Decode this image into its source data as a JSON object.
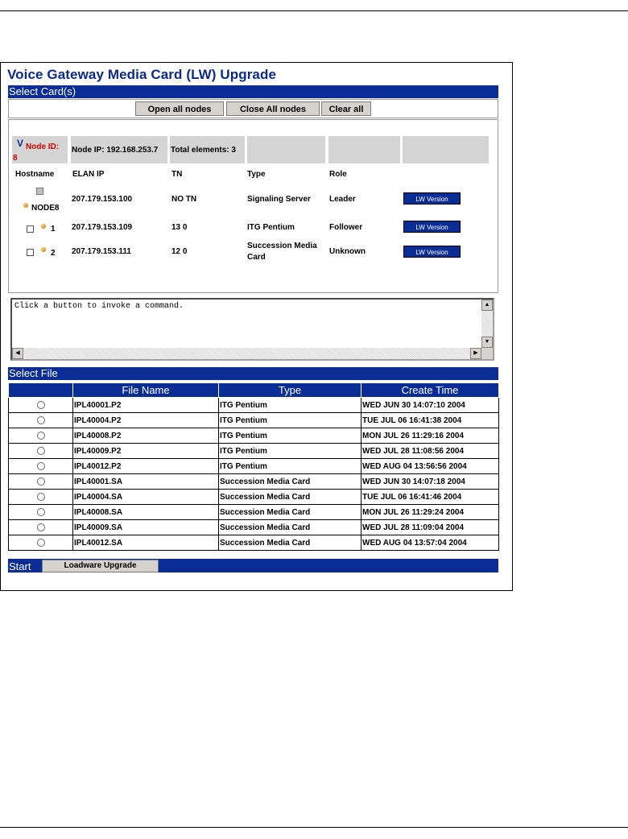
{
  "title": "Voice Gateway Media Card (LW) Upgrade",
  "select_cards_label": "Select Card(s)",
  "buttons": {
    "open_all": "Open all nodes",
    "close_all": "Close All nodes",
    "clear_all": "Clear all"
  },
  "node": {
    "arrow_glyph": "V",
    "id_label": "Node ID:",
    "id_value": "8",
    "ip_label": "Node IP: 192.168.253.7",
    "total_label": "Total elements: 3"
  },
  "columns": {
    "hostname": "Hostname",
    "elan_ip": "ELAN IP",
    "tn": "TN",
    "type": "Type",
    "role": "Role"
  },
  "cards": [
    {
      "hostname": "NODE8",
      "elan_ip": "207.179.153.100",
      "tn": "NO TN",
      "type": "Signaling Server",
      "role": "Leader",
      "button": "LW Version"
    },
    {
      "hostname": "1",
      "elan_ip": "207.179.153.109",
      "tn": "13 0",
      "type": "ITG Pentium",
      "role": "Follower",
      "button": "LW Version"
    },
    {
      "hostname": "2",
      "elan_ip": "207.179.153.111",
      "tn": "12 0",
      "type_line1": "Succession Media",
      "type_line2": "Card",
      "role": "Unknown",
      "button": "LW Version"
    }
  ],
  "output": {
    "text": "Click a button to invoke a command."
  },
  "select_file_label": "Select File",
  "file_columns": {
    "name": "File Name",
    "type": "Type",
    "time": "Create Time"
  },
  "files": [
    {
      "name": "IPL40001.P2",
      "type": "ITG Pentium",
      "time": "WED JUN 30 14:07:10 2004"
    },
    {
      "name": "IPL40004.P2",
      "type": "ITG Pentium",
      "time": "TUE JUL 06 16:41:38 2004"
    },
    {
      "name": "IPL40008.P2",
      "type": "ITG Pentium",
      "time": "MON JUL 26 11:29:16 2004"
    },
    {
      "name": "IPL40009.P2",
      "type": "ITG Pentium",
      "time": "WED JUL 28 11:08:56 2004"
    },
    {
      "name": "IPL40012.P2",
      "type": "ITG Pentium",
      "time": "WED AUG 04 13:56:56 2004"
    },
    {
      "name": "IPL40001.SA",
      "type": "Succession Media Card",
      "time": "WED JUN 30 14:07:18 2004"
    },
    {
      "name": "IPL40004.SA",
      "type": "Succession Media Card",
      "time": "TUE JUL 06 16:41:46 2004"
    },
    {
      "name": "IPL40008.SA",
      "type": "Succession Media Card",
      "time": "MON JUL 26 11:29:24 2004"
    },
    {
      "name": "IPL40009.SA",
      "type": "Succession Media Card",
      "time": "WED JUL 28 11:09:04 2004"
    },
    {
      "name": "IPL40012.SA",
      "type": "Succession Media Card",
      "time": "WED AUG 04 13:57:04 2004"
    }
  ],
  "start": {
    "label": "Start",
    "button": "Loadware Upgrade"
  },
  "scroll_glyphs": {
    "up": "▲",
    "down": "▼",
    "left": "◀",
    "right": "▶"
  }
}
